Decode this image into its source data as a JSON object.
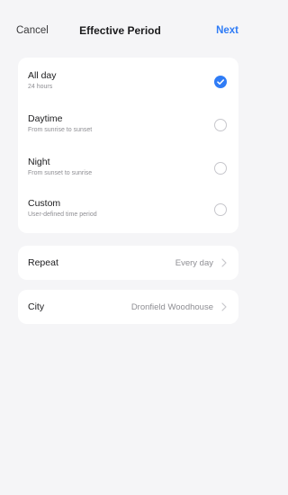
{
  "nav": {
    "cancel": "Cancel",
    "title": "Effective Period",
    "next": "Next"
  },
  "options": [
    {
      "label": "All day",
      "sub": "24 hours",
      "selected": true
    },
    {
      "label": "Daytime",
      "sub": "From sunrise to sunset",
      "selected": false
    },
    {
      "label": "Night",
      "sub": "From sunset to sunrise",
      "selected": false
    },
    {
      "label": "Custom",
      "sub": "User-defined time period",
      "selected": false
    }
  ],
  "repeat": {
    "label": "Repeat",
    "value": "Every day"
  },
  "city": {
    "label": "City",
    "value": "Dronfield Woodhouse"
  },
  "colors": {
    "accent": "#2f7cf6",
    "background": "#f5f5f7",
    "card": "#ffffff",
    "secondary_text": "#8e8e93"
  },
  "icons": {
    "selected": "checkmark-icon",
    "row_arrow": "chevron-right-icon"
  }
}
